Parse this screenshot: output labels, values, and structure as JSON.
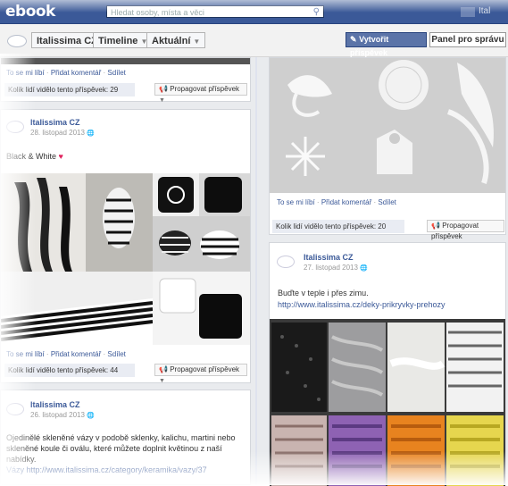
{
  "topbar": {
    "logo": "ebook",
    "search_placeholder": "Hledat osoby, místa a věci",
    "search_icon": "search-icon",
    "right_text": "Ital"
  },
  "toolbar": {
    "page_name": "Italissima CZ",
    "timeline": "Timeline",
    "current": "Aktuální",
    "dropdown_icon": "▼",
    "create_post": "Vytvořit příspěvek",
    "create_post_icon": "✎",
    "admin_panel": "Panel pro správu"
  },
  "left_posts": [
    {
      "actions": {
        "like": "To se mi líbí",
        "comment": "Přidat komentář",
        "share": "Sdílet"
      },
      "viewed": "Kolik lidí vidělo tento příspěvek: 29",
      "promote": "Propagovat příspěvek"
    },
    {
      "author": "Italissima CZ",
      "date": "28. listopad 2013",
      "text": "Black & White",
      "heart": "♥",
      "actions": {
        "like": "To se mi líbí",
        "comment": "Přidat komentář",
        "share": "Sdílet"
      },
      "viewed": "Kolik lidí vidělo tento příspěvek: 44",
      "promote": "Propagovat příspěvek"
    },
    {
      "author": "Italissima CZ",
      "date": "26. listopad 2013",
      "text_lines": [
        "Ojedinělé skleněné vázy v podobě sklenky, kalichu, martini nebo",
        "skleněné koule či oválu, které můžete doplnit květinou z naší",
        "nabídky.",
        "Vázy http://www.italissima.cz/category/keramika/vazy/37"
      ]
    }
  ],
  "right_posts": [
    {
      "actions": {
        "like": "To se mi líbí",
        "comment": "Přidat komentář",
        "share": "Sdílet"
      },
      "viewed": "Kolik lidí vidělo tento příspěvek: 20",
      "promote": "Propagovat příspěvek"
    },
    {
      "author": "Italissima CZ",
      "date": "27. listopad 2013",
      "text": "Buďte v teple i přes zimu.",
      "link": "http://www.italissima.cz/deky-prikryvky-prehozy"
    }
  ],
  "colors": {
    "facebook_blue": "#3b5998",
    "link_blue": "#3b5998",
    "heart_red": "#e0245e"
  }
}
